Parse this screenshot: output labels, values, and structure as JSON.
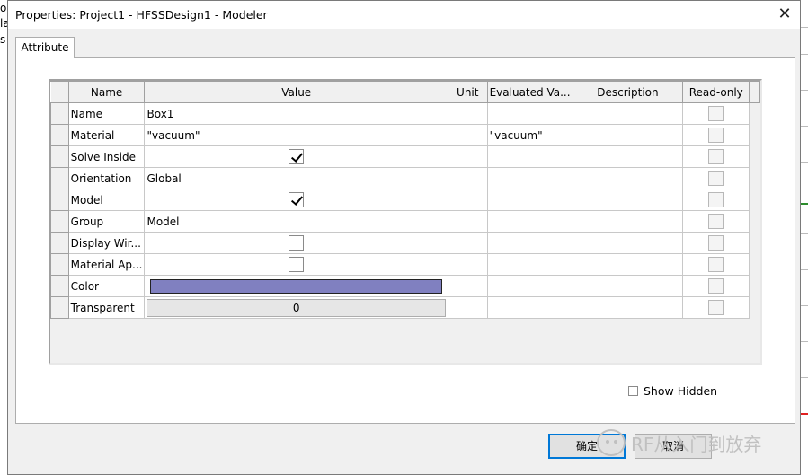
{
  "background": {
    "left_letters": [
      "o",
      "la",
      "s"
    ]
  },
  "dialog": {
    "title": "Properties: Project1 - HFSSDesign1 - Modeler",
    "close_symbol": "✕",
    "tab_label": "Attribute",
    "grid": {
      "columns": [
        "Name",
        "Value",
        "Unit",
        "Evaluated Va...",
        "Description",
        "Read-only"
      ],
      "rows": [
        {
          "name": "Name",
          "value": "Box1",
          "evaluated": ""
        },
        {
          "name": "Material",
          "value": "\"vacuum\"",
          "evaluated": "\"vacuum\""
        },
        {
          "name": "Solve Inside",
          "value_checkbox": true
        },
        {
          "name": "Orientation",
          "value": "Global",
          "evaluated": ""
        },
        {
          "name": "Model",
          "value_checkbox": true
        },
        {
          "name": "Group",
          "value": "Model",
          "evaluated": ""
        },
        {
          "name": "Display Wir...",
          "value_checkbox": false
        },
        {
          "name": "Material Ap...",
          "value_checkbox": false
        },
        {
          "name": "Color",
          "color": "#8080c0"
        },
        {
          "name": "Transparent",
          "value": "0"
        }
      ]
    },
    "show_hidden_label": "Show Hidden",
    "show_hidden_checked": false,
    "ok_label": "确定",
    "cancel_label": "取消"
  },
  "watermark": "RF从入门到放弃",
  "colors": {
    "accent": "#0078d7",
    "swatch": "#8080c0"
  }
}
